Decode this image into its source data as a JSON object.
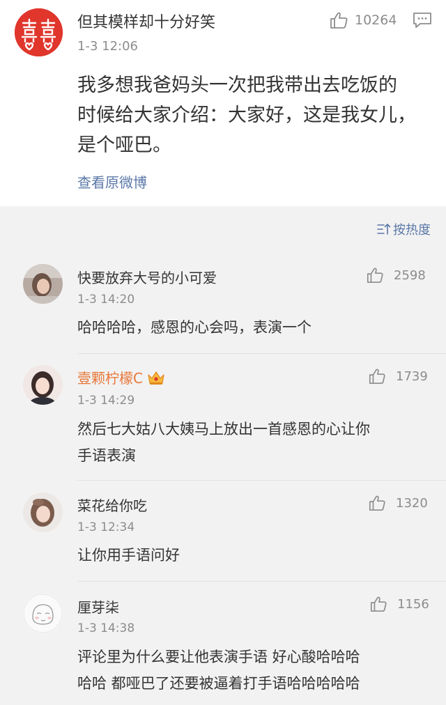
{
  "colors": {
    "page_background": "#f2f2f2",
    "card_background": "#ffffff",
    "link_blue": "#5b78a8",
    "meta_gray": "#8c8c8c",
    "vip_orange": "#e8773a",
    "avatar_red": "#e0362c"
  },
  "post": {
    "author": "但其模样却十分好笑",
    "avatar_icon": "double-happiness-avatar",
    "time": "1-3 12:06",
    "like_count": "10264",
    "like_icon": "thumbs-up-icon",
    "comment_icon": "comment-bubble-icon",
    "content_lines": [
      "我多想我爸妈头一次把我带出去吃饭的",
      "时候给大家介绍：大家好，这是我女儿，",
      "是个哑巴。"
    ],
    "view_original": "查看原微博"
  },
  "sort": {
    "label": "按热度",
    "icon": "sort-icon"
  },
  "comments": [
    {
      "name": "快要放弃大号的小可爱",
      "time": "1-3 14:20",
      "likes": "2598",
      "vip": false,
      "lines": [
        "哈哈哈哈，感恩的心会吗，表演一个"
      ]
    },
    {
      "name": "壹颗柠檬C",
      "time": "1-3 14:29",
      "likes": "1739",
      "vip": true,
      "badge_icon": "vip-crown-icon",
      "lines": [
        "然后七大姑八大姨马上放出一首感恩的心让你",
        "手语表演"
      ]
    },
    {
      "name": "菜花给你吃",
      "time": "1-3 12:34",
      "likes": "1320",
      "vip": false,
      "lines": [
        "让你用手语问好"
      ]
    },
    {
      "name": "厘芽柒",
      "time": "1-3 14:38",
      "likes": "1156",
      "vip": false,
      "lines": [
        "评论里为什么要让他表演手语  好心酸哈哈哈",
        "哈哈   都哑巴了还要被逼着打手语哈哈哈哈哈"
      ]
    }
  ]
}
